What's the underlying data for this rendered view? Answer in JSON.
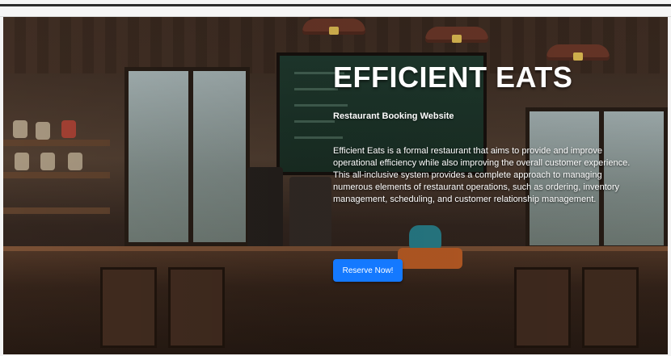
{
  "hero": {
    "title": "EFFICIENT EATS",
    "subtitle": "Restaurant Booking Website",
    "description": "Efficient Eats is a formal restaurant that aims to provide and improve operational efficiency while also improving the overall customer experience. This all-inclusive system provides a complete approach to managing numerous elements of restaurant operations, such as ordering, inventory management, scheduling, and customer relationship management.",
    "cta_label": "Reserve Now!"
  },
  "colors": {
    "accent": "#1479ff",
    "text": "#ffffff"
  }
}
